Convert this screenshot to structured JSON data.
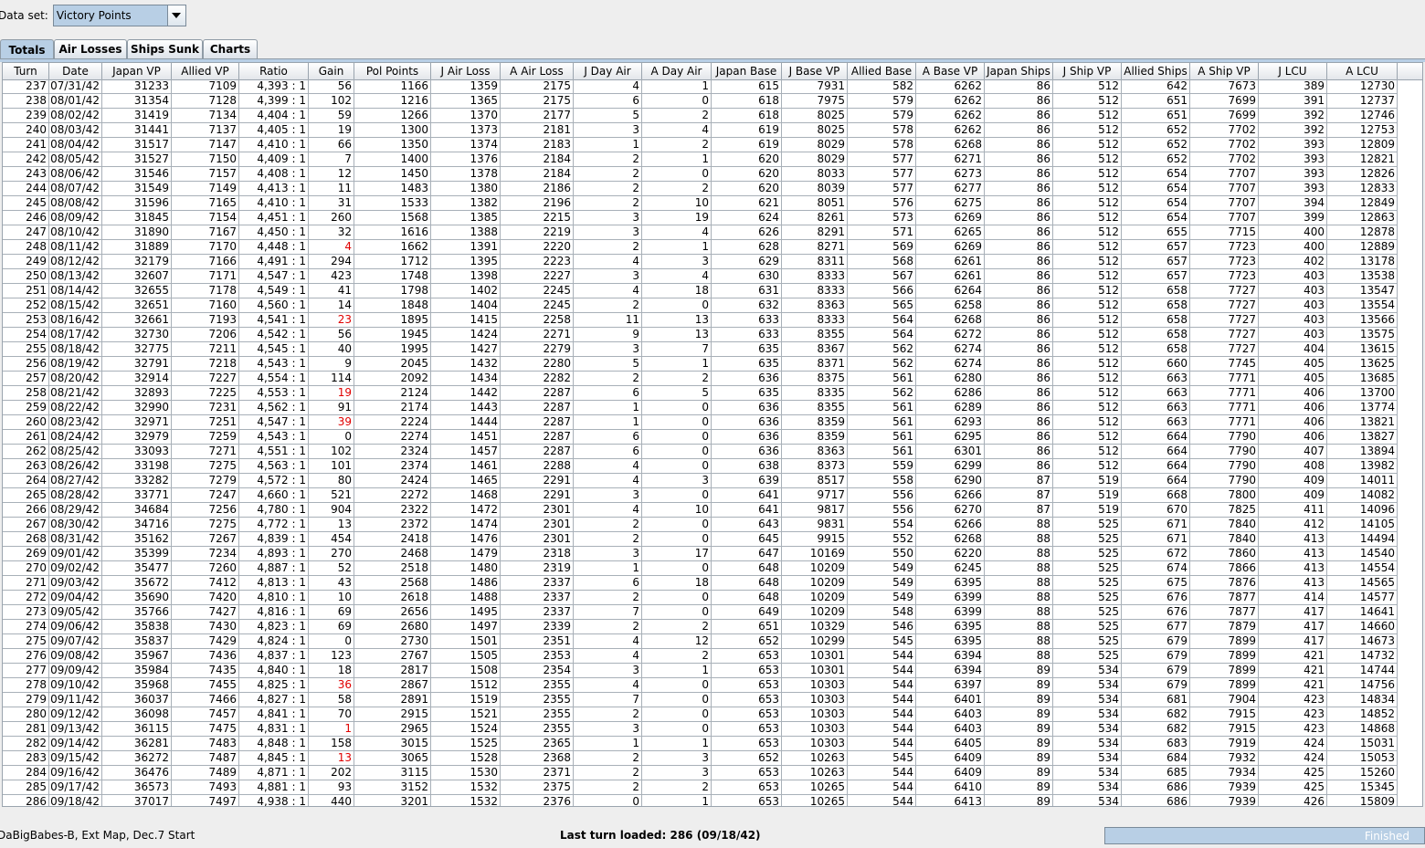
{
  "dataset": {
    "label": "Data set:",
    "value": "Victory Points"
  },
  "tabs": [
    "Totals",
    "Air Losses",
    "Ships Sunk",
    "Charts"
  ],
  "active_tab": 0,
  "table": {
    "columns": [
      "Turn",
      "Date",
      "Japan VP",
      "Allied VP",
      "Ratio",
      "Gain",
      "Pol Points",
      "J Air Loss",
      "A Air Loss",
      "J Day Air",
      "A Day Air",
      "Japan Base",
      "J Base VP",
      "Allied Base",
      "A Base VP",
      "Japan Ships",
      "J Ship VP",
      "Allied Ships",
      "A Ship VP",
      "J LCU",
      "A LCU"
    ],
    "rows": [
      [
        "237",
        "07/31/42",
        "31233",
        "7109",
        "4,393 : 1",
        "56",
        "1166",
        "1359",
        "2175",
        "4",
        "1",
        "615",
        "7931",
        "582",
        "6262",
        "86",
        "512",
        "642",
        "7673",
        "389",
        "12730"
      ],
      [
        "238",
        "08/01/42",
        "31354",
        "7128",
        "4,399 : 1",
        "102",
        "1216",
        "1365",
        "2175",
        "6",
        "0",
        "618",
        "7975",
        "579",
        "6262",
        "86",
        "512",
        "651",
        "7699",
        "391",
        "12737"
      ],
      [
        "239",
        "08/02/42",
        "31419",
        "7134",
        "4,404 : 1",
        "59",
        "1266",
        "1370",
        "2177",
        "5",
        "2",
        "618",
        "8025",
        "579",
        "6262",
        "86",
        "512",
        "651",
        "7699",
        "392",
        "12746"
      ],
      [
        "240",
        "08/03/42",
        "31441",
        "7137",
        "4,405 : 1",
        "19",
        "1300",
        "1373",
        "2181",
        "3",
        "4",
        "619",
        "8025",
        "578",
        "6262",
        "86",
        "512",
        "652",
        "7702",
        "392",
        "12753"
      ],
      [
        "241",
        "08/04/42",
        "31517",
        "7147",
        "4,410 : 1",
        "66",
        "1350",
        "1374",
        "2183",
        "1",
        "2",
        "619",
        "8029",
        "578",
        "6268",
        "86",
        "512",
        "652",
        "7702",
        "393",
        "12809"
      ],
      [
        "242",
        "08/05/42",
        "31527",
        "7150",
        "4,409 : 1",
        "7",
        "1400",
        "1376",
        "2184",
        "2",
        "1",
        "620",
        "8029",
        "577",
        "6271",
        "86",
        "512",
        "652",
        "7702",
        "393",
        "12821"
      ],
      [
        "243",
        "08/06/42",
        "31546",
        "7157",
        "4,408 : 1",
        "12",
        "1450",
        "1378",
        "2184",
        "2",
        "0",
        "620",
        "8033",
        "577",
        "6273",
        "86",
        "512",
        "654",
        "7707",
        "393",
        "12826"
      ],
      [
        "244",
        "08/07/42",
        "31549",
        "7149",
        "4,413 : 1",
        "11",
        "1483",
        "1380",
        "2186",
        "2",
        "2",
        "620",
        "8039",
        "577",
        "6277",
        "86",
        "512",
        "654",
        "7707",
        "393",
        "12833"
      ],
      [
        "245",
        "08/08/42",
        "31596",
        "7165",
        "4,410 : 1",
        "31",
        "1533",
        "1382",
        "2196",
        "2",
        "10",
        "621",
        "8051",
        "576",
        "6275",
        "86",
        "512",
        "654",
        "7707",
        "394",
        "12849"
      ],
      [
        "246",
        "08/09/42",
        "31845",
        "7154",
        "4,451 : 1",
        "260",
        "1568",
        "1385",
        "2215",
        "3",
        "19",
        "624",
        "8261",
        "573",
        "6269",
        "86",
        "512",
        "654",
        "7707",
        "399",
        "12863"
      ],
      [
        "247",
        "08/10/42",
        "31890",
        "7167",
        "4,450 : 1",
        "32",
        "1616",
        "1388",
        "2219",
        "3",
        "4",
        "626",
        "8291",
        "571",
        "6265",
        "86",
        "512",
        "655",
        "7715",
        "400",
        "12878"
      ],
      [
        "248",
        "08/11/42",
        "31889",
        "7170",
        "4,448 : 1",
        "4",
        "1662",
        "1391",
        "2220",
        "2",
        "1",
        "628",
        "8271",
        "569",
        "6269",
        "86",
        "512",
        "657",
        "7723",
        "400",
        "12889"
      ],
      [
        "249",
        "08/12/42",
        "32179",
        "7166",
        "4,491 : 1",
        "294",
        "1712",
        "1395",
        "2223",
        "4",
        "3",
        "629",
        "8311",
        "568",
        "6261",
        "86",
        "512",
        "657",
        "7723",
        "402",
        "13178"
      ],
      [
        "250",
        "08/13/42",
        "32607",
        "7171",
        "4,547 : 1",
        "423",
        "1748",
        "1398",
        "2227",
        "3",
        "4",
        "630",
        "8333",
        "567",
        "6261",
        "86",
        "512",
        "657",
        "7723",
        "403",
        "13538"
      ],
      [
        "251",
        "08/14/42",
        "32655",
        "7178",
        "4,549 : 1",
        "41",
        "1798",
        "1402",
        "2245",
        "4",
        "18",
        "631",
        "8333",
        "566",
        "6264",
        "86",
        "512",
        "658",
        "7727",
        "403",
        "13547"
      ],
      [
        "252",
        "08/15/42",
        "32651",
        "7160",
        "4,560 : 1",
        "14",
        "1848",
        "1404",
        "2245",
        "2",
        "0",
        "632",
        "8363",
        "565",
        "6258",
        "86",
        "512",
        "658",
        "7727",
        "403",
        "13554"
      ],
      [
        "253",
        "08/16/42",
        "32661",
        "7193",
        "4,541 : 1",
        "23",
        "1895",
        "1415",
        "2258",
        "11",
        "13",
        "633",
        "8333",
        "564",
        "6268",
        "86",
        "512",
        "658",
        "7727",
        "403",
        "13566"
      ],
      [
        "254",
        "08/17/42",
        "32730",
        "7206",
        "4,542 : 1",
        "56",
        "1945",
        "1424",
        "2271",
        "9",
        "13",
        "633",
        "8355",
        "564",
        "6272",
        "86",
        "512",
        "658",
        "7727",
        "403",
        "13575"
      ],
      [
        "255",
        "08/18/42",
        "32775",
        "7211",
        "4,545 : 1",
        "40",
        "1995",
        "1427",
        "2279",
        "3",
        "7",
        "635",
        "8367",
        "562",
        "6274",
        "86",
        "512",
        "658",
        "7727",
        "404",
        "13615"
      ],
      [
        "256",
        "08/19/42",
        "32791",
        "7218",
        "4,543 : 1",
        "9",
        "2045",
        "1432",
        "2280",
        "5",
        "1",
        "635",
        "8371",
        "562",
        "6274",
        "86",
        "512",
        "660",
        "7745",
        "405",
        "13625"
      ],
      [
        "257",
        "08/20/42",
        "32914",
        "7227",
        "4,554 : 1",
        "114",
        "2092",
        "1434",
        "2282",
        "2",
        "2",
        "636",
        "8375",
        "561",
        "6280",
        "86",
        "512",
        "663",
        "7771",
        "405",
        "13685"
      ],
      [
        "258",
        "08/21/42",
        "32893",
        "7225",
        "4,553 : 1",
        "19",
        "2124",
        "1442",
        "2287",
        "6",
        "5",
        "635",
        "8335",
        "562",
        "6286",
        "86",
        "512",
        "663",
        "7771",
        "406",
        "13700"
      ],
      [
        "259",
        "08/22/42",
        "32990",
        "7231",
        "4,562 : 1",
        "91",
        "2174",
        "1443",
        "2287",
        "1",
        "0",
        "636",
        "8355",
        "561",
        "6289",
        "86",
        "512",
        "663",
        "7771",
        "406",
        "13774"
      ],
      [
        "260",
        "08/23/42",
        "32971",
        "7251",
        "4,547 : 1",
        "39",
        "2224",
        "1444",
        "2287",
        "1",
        "0",
        "636",
        "8359",
        "561",
        "6293",
        "86",
        "512",
        "663",
        "7771",
        "406",
        "13821"
      ],
      [
        "261",
        "08/24/42",
        "32979",
        "7259",
        "4,543 : 1",
        "0",
        "2274",
        "1451",
        "2287",
        "6",
        "0",
        "636",
        "8359",
        "561",
        "6295",
        "86",
        "512",
        "664",
        "7790",
        "406",
        "13827"
      ],
      [
        "262",
        "08/25/42",
        "33093",
        "7271",
        "4,551 : 1",
        "102",
        "2324",
        "1457",
        "2287",
        "6",
        "0",
        "636",
        "8363",
        "561",
        "6301",
        "86",
        "512",
        "664",
        "7790",
        "407",
        "13894"
      ],
      [
        "263",
        "08/26/42",
        "33198",
        "7275",
        "4,563 : 1",
        "101",
        "2374",
        "1461",
        "2288",
        "4",
        "0",
        "638",
        "8373",
        "559",
        "6299",
        "86",
        "512",
        "664",
        "7790",
        "408",
        "13982"
      ],
      [
        "264",
        "08/27/42",
        "33282",
        "7279",
        "4,572 : 1",
        "80",
        "2424",
        "1465",
        "2291",
        "4",
        "3",
        "639",
        "8517",
        "558",
        "6290",
        "87",
        "519",
        "664",
        "7790",
        "409",
        "14011"
      ],
      [
        "265",
        "08/28/42",
        "33771",
        "7247",
        "4,660 : 1",
        "521",
        "2272",
        "1468",
        "2291",
        "3",
        "0",
        "641",
        "9717",
        "556",
        "6266",
        "87",
        "519",
        "668",
        "7800",
        "409",
        "14082"
      ],
      [
        "266",
        "08/29/42",
        "34684",
        "7256",
        "4,780 : 1",
        "904",
        "2322",
        "1472",
        "2301",
        "4",
        "10",
        "641",
        "9817",
        "556",
        "6270",
        "87",
        "519",
        "670",
        "7825",
        "411",
        "14096"
      ],
      [
        "267",
        "08/30/42",
        "34716",
        "7275",
        "4,772 : 1",
        "13",
        "2372",
        "1474",
        "2301",
        "2",
        "0",
        "643",
        "9831",
        "554",
        "6266",
        "88",
        "525",
        "671",
        "7840",
        "412",
        "14105"
      ],
      [
        "268",
        "08/31/42",
        "35162",
        "7267",
        "4,839 : 1",
        "454",
        "2418",
        "1476",
        "2301",
        "2",
        "0",
        "645",
        "9915",
        "552",
        "6268",
        "88",
        "525",
        "671",
        "7840",
        "413",
        "14494"
      ],
      [
        "269",
        "09/01/42",
        "35399",
        "7234",
        "4,893 : 1",
        "270",
        "2468",
        "1479",
        "2318",
        "3",
        "17",
        "647",
        "10169",
        "550",
        "6220",
        "88",
        "525",
        "672",
        "7860",
        "413",
        "14540"
      ],
      [
        "270",
        "09/02/42",
        "35477",
        "7260",
        "4,887 : 1",
        "52",
        "2518",
        "1480",
        "2319",
        "1",
        "0",
        "648",
        "10209",
        "549",
        "6245",
        "88",
        "525",
        "674",
        "7866",
        "413",
        "14554"
      ],
      [
        "271",
        "09/03/42",
        "35672",
        "7412",
        "4,813 : 1",
        "43",
        "2568",
        "1486",
        "2337",
        "6",
        "18",
        "648",
        "10209",
        "549",
        "6395",
        "88",
        "525",
        "675",
        "7876",
        "413",
        "14565"
      ],
      [
        "272",
        "09/04/42",
        "35690",
        "7420",
        "4,810 : 1",
        "10",
        "2618",
        "1488",
        "2337",
        "2",
        "0",
        "648",
        "10209",
        "549",
        "6399",
        "88",
        "525",
        "676",
        "7877",
        "414",
        "14577"
      ],
      [
        "273",
        "09/05/42",
        "35766",
        "7427",
        "4,816 : 1",
        "69",
        "2656",
        "1495",
        "2337",
        "7",
        "0",
        "649",
        "10209",
        "548",
        "6399",
        "88",
        "525",
        "676",
        "7877",
        "417",
        "14641"
      ],
      [
        "274",
        "09/06/42",
        "35838",
        "7430",
        "4,823 : 1",
        "69",
        "2680",
        "1497",
        "2339",
        "2",
        "2",
        "651",
        "10329",
        "546",
        "6395",
        "88",
        "525",
        "677",
        "7879",
        "417",
        "14660"
      ],
      [
        "275",
        "09/07/42",
        "35837",
        "7429",
        "4,824 : 1",
        "0",
        "2730",
        "1501",
        "2351",
        "4",
        "12",
        "652",
        "10299",
        "545",
        "6395",
        "88",
        "525",
        "679",
        "7899",
        "417",
        "14673"
      ],
      [
        "276",
        "09/08/42",
        "35967",
        "7436",
        "4,837 : 1",
        "123",
        "2767",
        "1505",
        "2353",
        "4",
        "2",
        "653",
        "10301",
        "544",
        "6394",
        "88",
        "525",
        "679",
        "7899",
        "421",
        "14732"
      ],
      [
        "277",
        "09/09/42",
        "35984",
        "7435",
        "4,840 : 1",
        "18",
        "2817",
        "1508",
        "2354",
        "3",
        "1",
        "653",
        "10301",
        "544",
        "6394",
        "89",
        "534",
        "679",
        "7899",
        "421",
        "14744"
      ],
      [
        "278",
        "09/10/42",
        "35968",
        "7455",
        "4,825 : 1",
        "36",
        "2867",
        "1512",
        "2355",
        "4",
        "0",
        "653",
        "10303",
        "544",
        "6397",
        "89",
        "534",
        "679",
        "7899",
        "421",
        "14756"
      ],
      [
        "279",
        "09/11/42",
        "36037",
        "7466",
        "4,827 : 1",
        "58",
        "2891",
        "1519",
        "2355",
        "7",
        "0",
        "653",
        "10303",
        "544",
        "6401",
        "89",
        "534",
        "681",
        "7904",
        "423",
        "14834"
      ],
      [
        "280",
        "09/12/42",
        "36098",
        "7457",
        "4,841 : 1",
        "70",
        "2915",
        "1521",
        "2355",
        "2",
        "0",
        "653",
        "10303",
        "544",
        "6403",
        "89",
        "534",
        "682",
        "7915",
        "423",
        "14852"
      ],
      [
        "281",
        "09/13/42",
        "36115",
        "7475",
        "4,831 : 1",
        "1",
        "2965",
        "1524",
        "2355",
        "3",
        "0",
        "653",
        "10303",
        "544",
        "6403",
        "89",
        "534",
        "682",
        "7915",
        "423",
        "14868"
      ],
      [
        "282",
        "09/14/42",
        "36281",
        "7483",
        "4,848 : 1",
        "158",
        "3015",
        "1525",
        "2365",
        "1",
        "1",
        "653",
        "10303",
        "544",
        "6405",
        "89",
        "534",
        "683",
        "7919",
        "424",
        "15031"
      ],
      [
        "283",
        "09/15/42",
        "36272",
        "7487",
        "4,845 : 1",
        "13",
        "3065",
        "1528",
        "2368",
        "2",
        "3",
        "652",
        "10263",
        "545",
        "6409",
        "89",
        "534",
        "684",
        "7932",
        "424",
        "15053"
      ],
      [
        "284",
        "09/16/42",
        "36476",
        "7489",
        "4,871 : 1",
        "202",
        "3115",
        "1530",
        "2371",
        "2",
        "3",
        "653",
        "10263",
        "544",
        "6409",
        "89",
        "534",
        "685",
        "7934",
        "425",
        "15260"
      ],
      [
        "285",
        "09/17/42",
        "36573",
        "7493",
        "4,881 : 1",
        "93",
        "3152",
        "1532",
        "2375",
        "2",
        "2",
        "653",
        "10265",
        "544",
        "6410",
        "89",
        "534",
        "686",
        "7939",
        "425",
        "15345"
      ],
      [
        "286",
        "09/18/42",
        "37017",
        "7497",
        "4,938 : 1",
        "440",
        "3201",
        "1532",
        "2376",
        "0",
        "1",
        "653",
        "10265",
        "544",
        "6413",
        "89",
        "534",
        "686",
        "7939",
        "426",
        "15809"
      ]
    ],
    "negative_gain_rows": [
      11,
      16,
      21,
      23,
      41,
      44,
      46
    ],
    "negative_color": "#e00000"
  },
  "status": {
    "scenario": "DaBigBabes-B, Ext Map, Dec.7 Start",
    "last_turn": "Last turn loaded: 286 (09/18/42)",
    "progress_label": "Finished",
    "progress_fraction": 1.0
  }
}
